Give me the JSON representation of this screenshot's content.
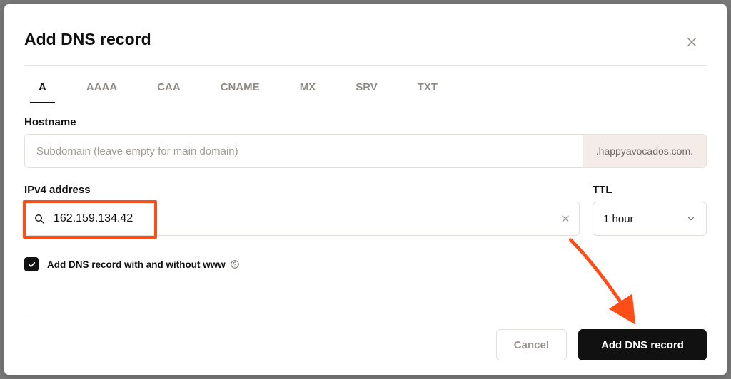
{
  "modal": {
    "title": "Add DNS record"
  },
  "tabs": [
    "A",
    "AAAA",
    "CAA",
    "CNAME",
    "MX",
    "SRV",
    "TXT"
  ],
  "active_tab_index": 0,
  "hostname": {
    "label": "Hostname",
    "placeholder": "Subdomain (leave empty for main domain)",
    "value": "",
    "domain_suffix": ".happyavocados.com."
  },
  "ipv4": {
    "label": "IPv4 address",
    "value": "162.159.134.42"
  },
  "ttl": {
    "label": "TTL",
    "value": "1 hour"
  },
  "www_checkbox": {
    "checked": true,
    "label": "Add DNS record with and without www"
  },
  "buttons": {
    "cancel": "Cancel",
    "submit": "Add DNS record"
  },
  "annotation": {
    "highlight_color": "#ff4d17"
  }
}
